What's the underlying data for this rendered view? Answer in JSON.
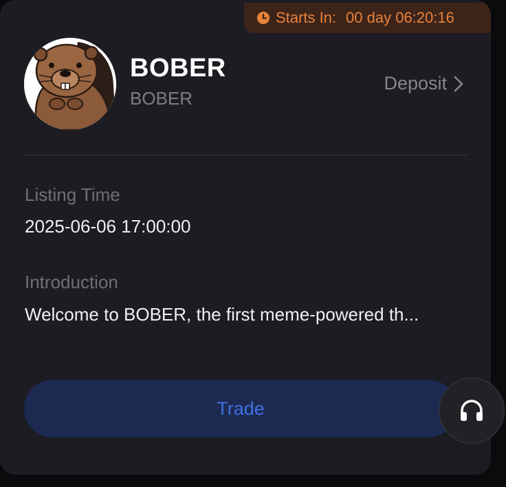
{
  "badge": {
    "label": "Starts In:",
    "value": "00 day 06:20:16",
    "icon": "clock-icon",
    "color": "#e8823a"
  },
  "token": {
    "name": "BOBER",
    "symbol": "BOBER",
    "avatar_icon": "beaver-avatar"
  },
  "deposit": {
    "label": "Deposit",
    "icon": "chevron-right-icon"
  },
  "listing": {
    "label": "Listing Time",
    "value": "2025-06-06 17:00:00"
  },
  "introduction": {
    "label": "Introduction",
    "value": "Welcome to BOBER, the first meme-powered th..."
  },
  "trade": {
    "label": "Trade",
    "color": "#3f6fe0"
  },
  "support": {
    "icon": "headset-icon"
  }
}
